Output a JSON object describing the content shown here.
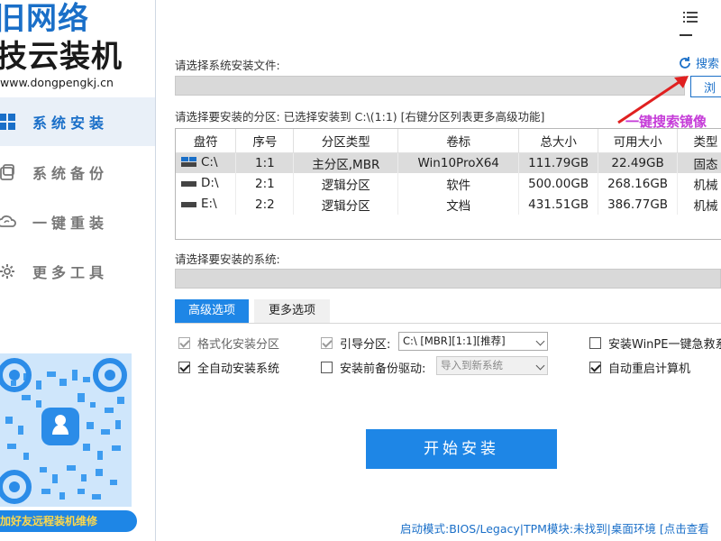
{
  "sidebar": {
    "logo_line1": "旧网络",
    "logo_line2": "技云装机",
    "logo_url": "www.dongpengkj.cn",
    "items": [
      {
        "label": "系统安装",
        "icon": "windows-icon",
        "active": true
      },
      {
        "label": "系统备份",
        "icon": "backup-icon",
        "active": false
      },
      {
        "label": "一键重装",
        "icon": "cloud-refresh-icon",
        "active": false
      },
      {
        "label": "更多工具",
        "icon": "gear-icon",
        "active": false
      }
    ],
    "qr_banner": "加好友远程装机维修"
  },
  "main": {
    "file_label": "请选择系统安装文件:",
    "search_label": "搜索",
    "browse_label": "浏",
    "annotation": "一键搜索镜像",
    "partition_label": "请选择要安装的分区: 已选择安装到 C:\\(1:1) [右键分区列表更多高级功能]",
    "table": {
      "headers": [
        "盘符",
        "序号",
        "分区类型",
        "卷标",
        "总大小",
        "可用大小",
        "类型"
      ],
      "rows": [
        {
          "drive": "C:\\",
          "index": "1:1",
          "ptype": "主分区,MBR",
          "label": "Win10ProX64",
          "total": "111.79GB",
          "free": "22.49GB",
          "kind": "固态",
          "selected": true
        },
        {
          "drive": "D:\\",
          "index": "2:1",
          "ptype": "逻辑分区",
          "label": "软件",
          "total": "500.00GB",
          "free": "268.16GB",
          "kind": "机械",
          "selected": false
        },
        {
          "drive": "E:\\",
          "index": "2:2",
          "ptype": "逻辑分区",
          "label": "文档",
          "total": "431.51GB",
          "free": "386.77GB",
          "kind": "机械",
          "selected": false
        }
      ]
    },
    "system_label": "请选择要安装的系统:",
    "tabs": [
      {
        "label": "高级选项",
        "active": true
      },
      {
        "label": "更多选项",
        "active": false
      }
    ],
    "options": {
      "format": {
        "label": "格式化安装分区",
        "checked": true,
        "disabled": true
      },
      "boot": {
        "label": "引导分区:",
        "checked": true,
        "disabled": true
      },
      "boot_value": "C:\\ [MBR][1:1][推荐]",
      "winpe": {
        "label": "安装WinPE一键急救系",
        "checked": false
      },
      "auto_install": {
        "label": "全自动安装系统",
        "checked": true
      },
      "backup_driver": {
        "label": "安装前备份驱动:",
        "checked": false
      },
      "driver_value": "导入到新系统",
      "auto_reboot": {
        "label": "自动重启计算机",
        "checked": true
      }
    },
    "start_label": "开始安装",
    "status": "启动模式:BIOS/Legacy|TPM模块:未找到|桌面环境 [点击查看"
  },
  "colors": {
    "accent": "#1e86e6",
    "annotation": "#c53cd8",
    "arrow": "#e02020"
  }
}
